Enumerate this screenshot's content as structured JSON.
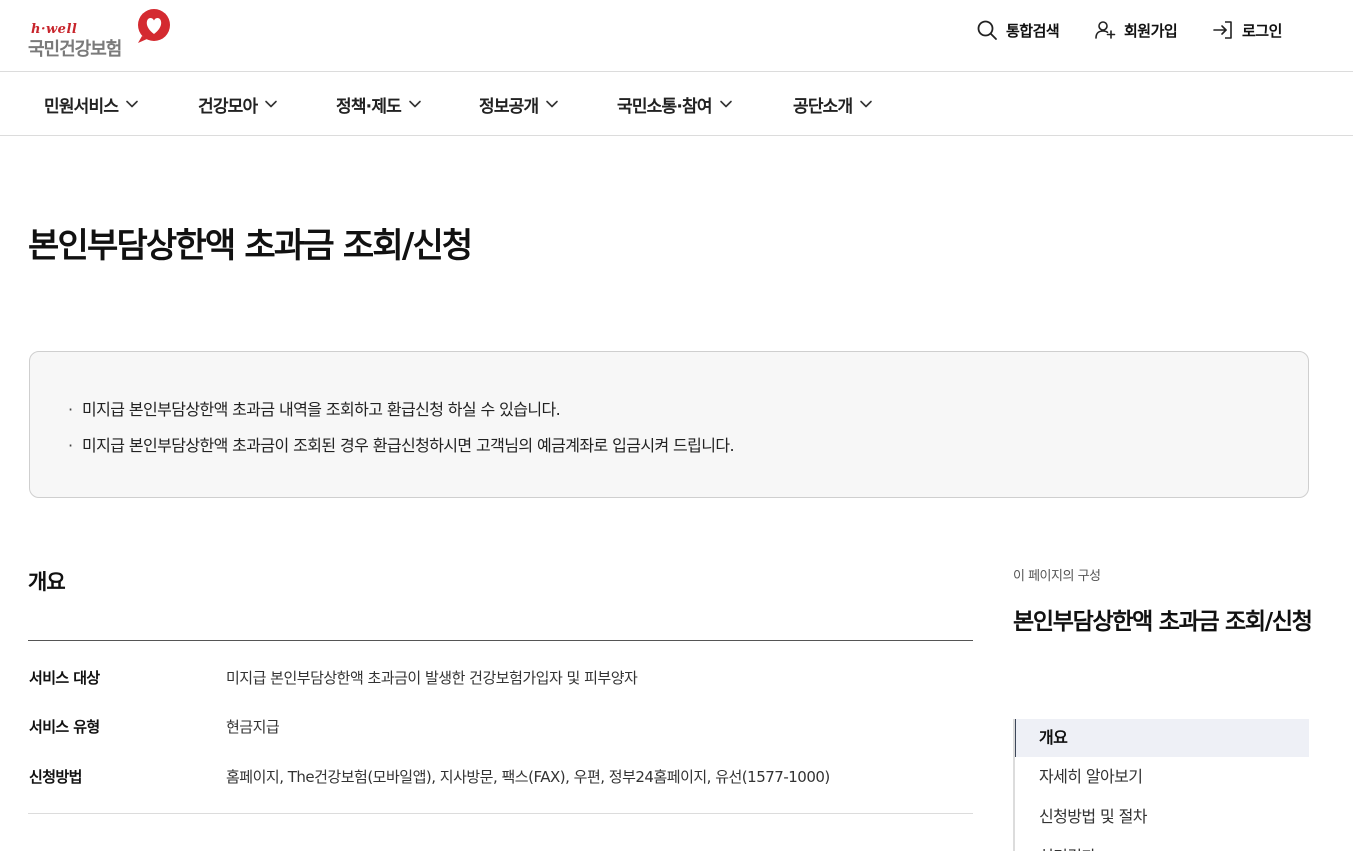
{
  "header": {
    "logo_sub": "h·well",
    "logo_main": "국민건강보험",
    "utility": {
      "search": "통합검색",
      "join": "회원가입",
      "login": "로그인"
    }
  },
  "gnb": {
    "items": [
      {
        "label": "민원서비스"
      },
      {
        "label": "건강모아"
      },
      {
        "label": "정책·제도"
      },
      {
        "label": "정보공개"
      },
      {
        "label": "국민소통·참여"
      },
      {
        "label": "공단소개"
      }
    ]
  },
  "page": {
    "title": "본인부담상한액 초과금 조회/신청"
  },
  "notice": {
    "lines": [
      "미지급 본인부담상한액 초과금 내역을 조회하고 환급신청 하실 수 있습니다.",
      "미지급 본인부담상한액 초과금이 조회된 경우 환급신청하시면 고객님의 예금계좌로 입금시켜 드립니다."
    ]
  },
  "overview": {
    "title": "개요",
    "rows": [
      {
        "label": "서비스 대상",
        "value": "미지급 본인부담상한액 초과금이 발생한 건강보험가입자 및 피부양자"
      },
      {
        "label": "서비스 유형",
        "value": "현금지급"
      },
      {
        "label": "신청방법",
        "value": "홈페이지, The건강보험(모바일앱), 지사방문, 팩스(FAX), 우편, 정부24홈페이지, 유선(1577-1000)"
      }
    ]
  },
  "toc": {
    "caption": "이 페이지의 구성",
    "title": "본인부담상한액 초과금 조회/신청",
    "items": [
      {
        "label": "개요"
      },
      {
        "label": "자세히 알아보기"
      },
      {
        "label": "신청방법 및 절차"
      },
      {
        "label": "처리결과"
      }
    ]
  },
  "colors": {
    "brand_red": "#c8252c",
    "toc_active_bg": "#eef0f6",
    "toc_active_bar": "#3d4759"
  }
}
